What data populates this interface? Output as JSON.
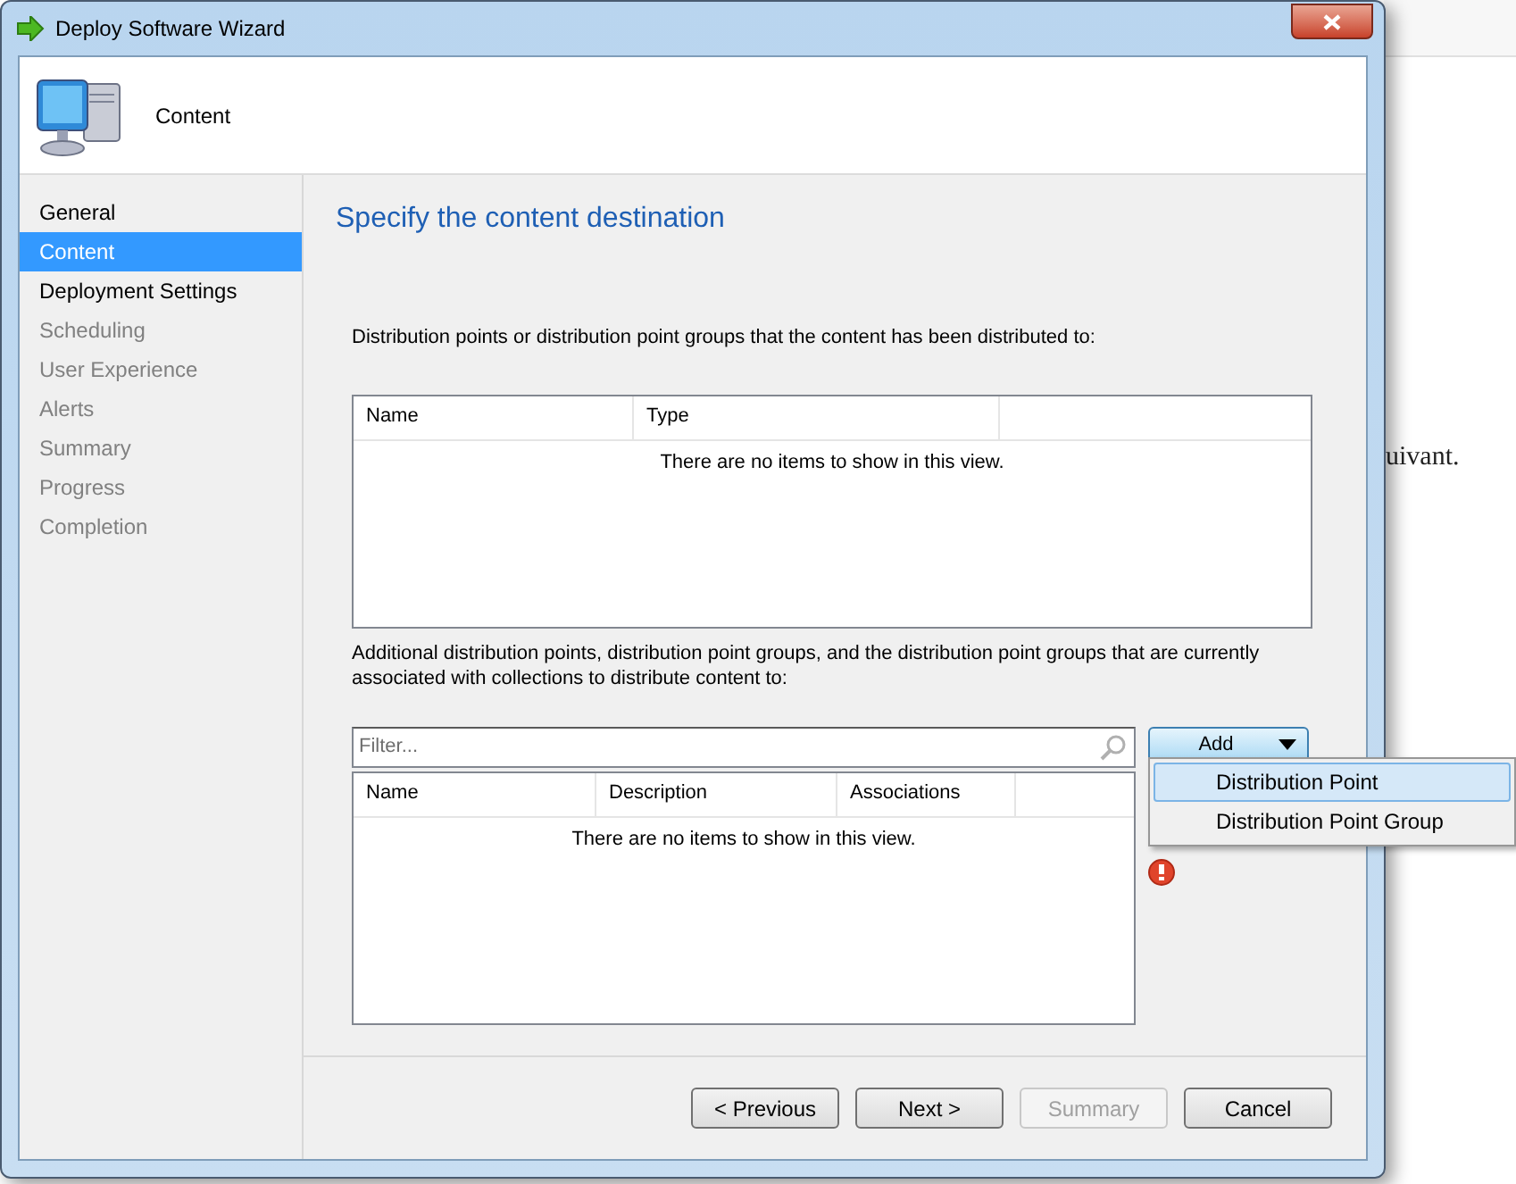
{
  "background_page": {
    "text": "uivant."
  },
  "window": {
    "title": "Deploy Software Wizard"
  },
  "header": {
    "title": "Content"
  },
  "sidebar": {
    "items": [
      {
        "label": "General",
        "selected": false,
        "disabled": false
      },
      {
        "label": "Content",
        "selected": true,
        "disabled": false
      },
      {
        "label": "Deployment Settings",
        "selected": false,
        "disabled": false
      },
      {
        "label": "Scheduling",
        "selected": false,
        "disabled": true
      },
      {
        "label": "User Experience",
        "selected": false,
        "disabled": true
      },
      {
        "label": "Alerts",
        "selected": false,
        "disabled": true
      },
      {
        "label": "Summary",
        "selected": false,
        "disabled": true
      },
      {
        "label": "Progress",
        "selected": false,
        "disabled": true
      },
      {
        "label": "Completion",
        "selected": false,
        "disabled": true
      }
    ]
  },
  "page_title": "Specify the content destination",
  "distributed_section": {
    "description": "Distribution points or distribution point groups that the content has been distributed to:",
    "table": {
      "columns": [
        "Name",
        "Type"
      ],
      "empty_message": "There are no items to show in this view."
    }
  },
  "additional_section": {
    "description": "Additional distribution points, distribution point groups, and the distribution point groups that are currently associated with collections to distribute content to:",
    "filter": {
      "placeholder": "Filter..."
    },
    "add_button": {
      "label": "Add",
      "expanded": true
    },
    "add_menu": [
      {
        "label": "Distribution Point",
        "selected": true
      },
      {
        "label": "Distribution Point Group",
        "selected": false
      }
    ],
    "table": {
      "columns": [
        "Name",
        "Description",
        "Associations"
      ],
      "empty_message": "There are no items to show in this view."
    }
  },
  "buttons": [
    {
      "label": "< Previous",
      "disabled": false
    },
    {
      "label": "Next >",
      "disabled": false
    },
    {
      "label": "Summary",
      "disabled": true
    },
    {
      "label": "Cancel",
      "disabled": false
    }
  ]
}
